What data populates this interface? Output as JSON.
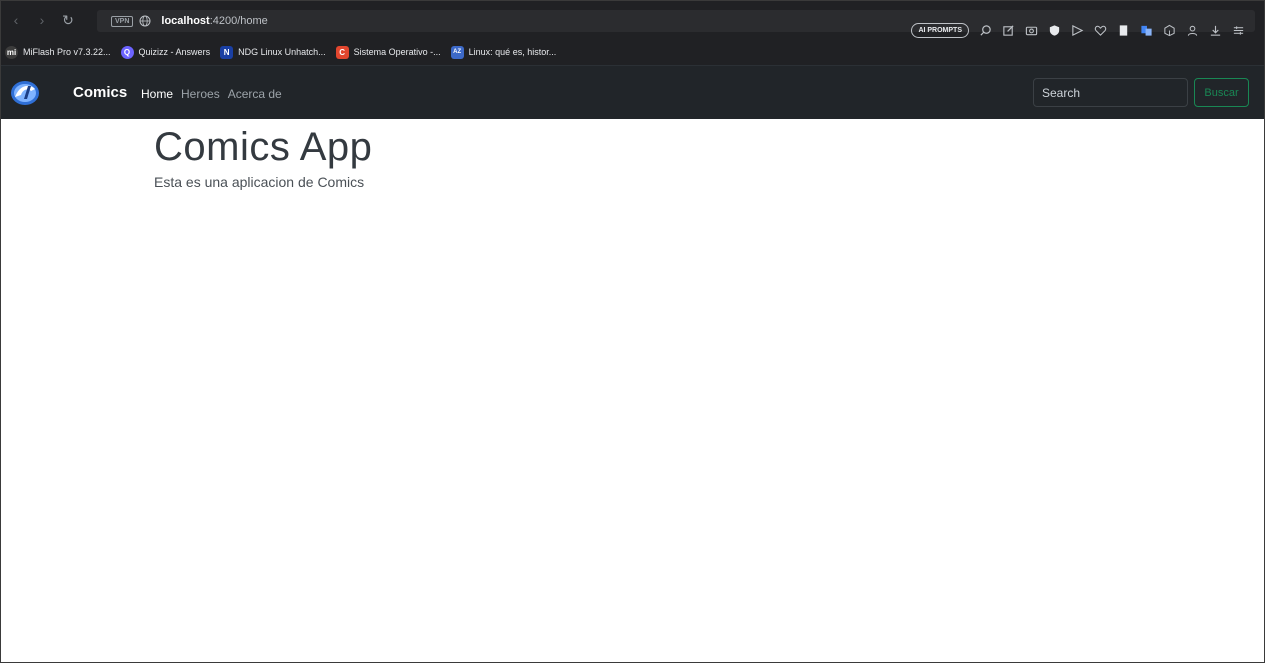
{
  "browser": {
    "url_host": "localhost",
    "url_path": ":4200/home",
    "vpn_label": "VPN",
    "ai_prompts_label": "AI PROMPTS"
  },
  "bookmarks": [
    {
      "label": "MiFlash Pro v7.3.22...",
      "icon_text": "mi",
      "color": "#3c3c3c"
    },
    {
      "label": "Quizizz - Answers",
      "icon_text": "Q",
      "color": "#6c63ff"
    },
    {
      "label": "NDG Linux Unhatch...",
      "icon_text": "N",
      "color": "#1a3fa3"
    },
    {
      "label": "Sistema Operativo -...",
      "icon_text": "C",
      "color": "#e2462e"
    },
    {
      "label": "Linux: qué es, histor...",
      "icon_text": "AZ",
      "color": "#3d6ac9"
    }
  ],
  "navbar": {
    "brand": "Comics",
    "links": [
      {
        "label": "Home",
        "active": true
      },
      {
        "label": "Heroes",
        "active": false
      },
      {
        "label": "Acerca de",
        "active": false
      }
    ],
    "search_placeholder": "Search",
    "search_button": "Buscar"
  },
  "main": {
    "title": "Comics App",
    "subtitle": "Esta es una aplicacion de Comics"
  },
  "colors": {
    "navbar_bg": "#212529",
    "browser_bg": "#202124",
    "success": "#198754"
  }
}
